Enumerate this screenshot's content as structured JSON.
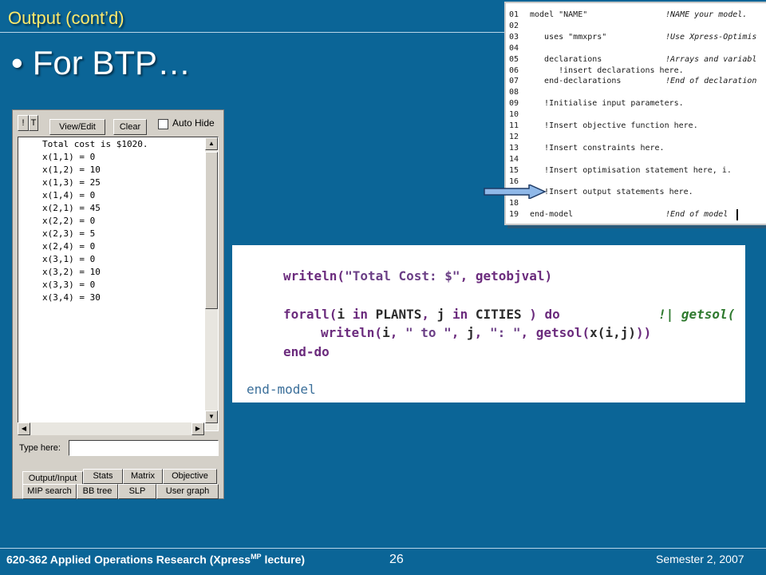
{
  "slide": {
    "title": "Output (cont’d)",
    "bullet": "For BTP…",
    "footer_left": "620-362 Applied Operations Research (Xpress",
    "footer_left_sup": "MP",
    "footer_left_tail": " lecture)",
    "page_number": "26",
    "footer_right": "Semester 2, 2007"
  },
  "editor": {
    "lines": [
      {
        "num": "01",
        "code": "model \"NAME\"",
        "comment": "!NAME your model."
      },
      {
        "num": "02",
        "code": "",
        "comment": ""
      },
      {
        "num": "03",
        "code": "   uses \"mmxprs\"",
        "comment": "!Use Xpress-Optimis"
      },
      {
        "num": "04",
        "code": "",
        "comment": ""
      },
      {
        "num": "05",
        "code": "   declarations",
        "comment": "!Arrays and variabl"
      },
      {
        "num": "06",
        "code": "      !insert declarations here.",
        "comment": ""
      },
      {
        "num": "07",
        "code": "   end-declarations",
        "comment": "!End of declaration"
      },
      {
        "num": "08",
        "code": "",
        "comment": ""
      },
      {
        "num": "09",
        "code": "   !Initialise input parameters.",
        "comment": ""
      },
      {
        "num": "10",
        "code": "",
        "comment": ""
      },
      {
        "num": "11",
        "code": "   !Insert objective function here.",
        "comment": ""
      },
      {
        "num": "12",
        "code": "",
        "comment": ""
      },
      {
        "num": "13",
        "code": "   !Insert constraints here.",
        "comment": ""
      },
      {
        "num": "14",
        "code": "",
        "comment": ""
      },
      {
        "num": "15",
        "code": "   !Insert optimisation statement here, i.",
        "comment": ""
      },
      {
        "num": "16",
        "code": "",
        "comment": ""
      },
      {
        "num": "17",
        "code": "   !Insert output statements here.",
        "comment": ""
      },
      {
        "num": "18",
        "code": "",
        "comment": ""
      },
      {
        "num": "19",
        "code": "end-model",
        "comment": "!End of model"
      }
    ]
  },
  "output_window": {
    "toolbar": {
      "icon1": "!",
      "icon2": "T",
      "view_edit": "View/Edit",
      "clear": "Clear",
      "auto_hide": "Auto Hide"
    },
    "lines": [
      "Total cost is $1020.",
      "x(1,1) = 0",
      "x(1,2) = 10",
      "x(1,3) = 25",
      "x(1,4) = 0",
      "x(2,1) = 45",
      "x(2,2) = 0",
      "x(2,3) = 5",
      "x(2,4) = 0",
      "x(3,1) = 0",
      "x(3,2) = 10",
      "x(3,3) = 0",
      "x(3,4) = 30"
    ],
    "type_here": "Type here:",
    "tabs_row1": [
      "Output/Input",
      "Stats",
      "Matrix",
      "Objective"
    ],
    "tabs_row2": [
      "MIP search",
      "BB tree",
      "SLP",
      "User graph"
    ]
  },
  "snippet": {
    "l1a": "writeln(",
    "l1b": "\"Total Cost: $\"",
    "l1c": ", getobjval)",
    "l2a": "forall(",
    "l2b": "i",
    "l2c": " in ",
    "l2d": "PLANTS",
    "l2e": ", ",
    "l2f": "j",
    "l2g": " in ",
    "l2h": "CITIES",
    "l2i": " ) do",
    "l2j": "!| getsol(",
    "l3a": "writeln(",
    "l3b": "i",
    "l3c": ", ",
    "l3d": "\" to \"",
    "l3e": ", ",
    "l3f": "j",
    "l3g": ", ",
    "l3h": "\": \"",
    "l3i": ", getsol(",
    "l3j": "x(i,j)",
    "l3k": "))",
    "l4": "end-do",
    "l5": "end-model"
  }
}
